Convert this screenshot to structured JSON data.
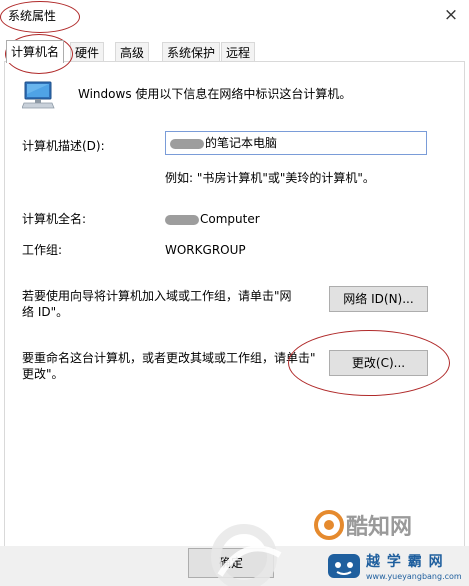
{
  "window": {
    "title": "系统属性",
    "close_glyph": "×"
  },
  "tabs": [
    {
      "label": "计算机名",
      "active": true
    },
    {
      "label": "硬件",
      "active": false
    },
    {
      "label": "高级",
      "active": false
    },
    {
      "label": "系统保护",
      "active": false
    },
    {
      "label": "远程",
      "active": false
    }
  ],
  "computer_name_tab": {
    "intro_text": "Windows 使用以下信息在网络中标识这台计算机。",
    "description_label": "计算机描述(D):",
    "description_value": "的笔记本电脑",
    "description_example": "例如: \"书房计算机\"或\"美玲的计算机\"。",
    "full_name_label": "计算机全名:",
    "full_name_value": "Computer",
    "workgroup_label": "工作组:",
    "workgroup_value": "WORKGROUP",
    "network_id_text_line1": "若要使用向导将计算机加入域或工作组，请单击\"网",
    "network_id_text_line2": "络 ID\"。",
    "network_id_button": "网络 ID(N)...",
    "rename_text_line1": "要重命名这台计算机，或者更改其域或工作组，请单击\"",
    "rename_text_line2": "更改\"。",
    "change_button": "更改(C)..."
  },
  "bottom_buttons": {
    "ok_label": "确定"
  },
  "watermarks": {
    "logo_text": "酷知网",
    "site_text": "越 学 霸 网",
    "site_url": "www.yueyangbang.com"
  },
  "colors": {
    "annotation_red": "#b02a2a",
    "input_border": "#7a9cd8",
    "button_face": "#e1e1e1"
  }
}
